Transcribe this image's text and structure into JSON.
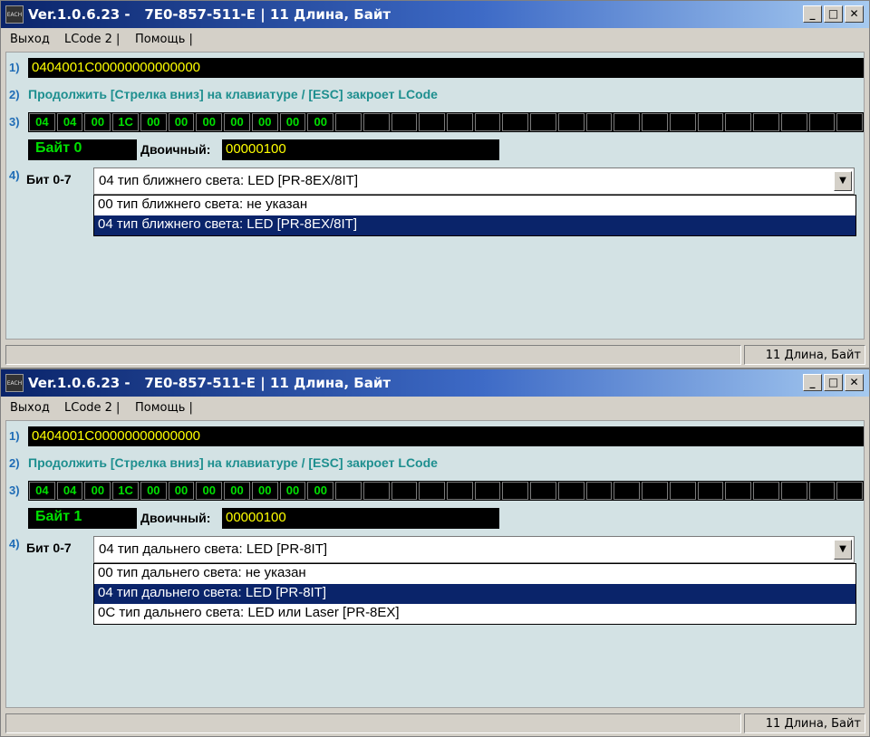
{
  "windows": [
    {
      "title": "Ver.1.0.6.23 -   7E0-857-511-E | 11 Длина, Байт",
      "app_icon_text": "EACH",
      "window_buttons": {
        "minimize": "_",
        "maximize": "□",
        "close": "✕"
      },
      "menu": [
        "Выход",
        "LCode 2 |",
        "Помощь |"
      ],
      "step_labels": [
        "1)",
        "2)",
        "3)",
        "4)"
      ],
      "lcode": "0404001C00000000000000",
      "hint": "Продолжить [Стрелка вниз] на клавиатуре / [ESC] закроет LCode",
      "bytes": [
        "04",
        "04",
        "00",
        "1C",
        "00",
        "00",
        "00",
        "00",
        "00",
        "00",
        "00",
        "",
        "",
        "",
        "",
        "",
        "",
        "",
        "",
        "",
        "",
        "",
        "",
        "",
        "",
        "",
        "",
        "",
        "",
        ""
      ],
      "byte_label": "Байт 0",
      "binary_label": "Двоичный:",
      "binary_value": "00000100",
      "bit_label": "Бит 0-7",
      "combo_value": "04 тип ближнего света: LED [PR-8EX/8IT]",
      "combo_arrow": "▼",
      "options": [
        {
          "label": "00 тип ближнего света: не указан",
          "selected": false
        },
        {
          "label": "04 тип ближнего света: LED [PR-8EX/8IT]",
          "selected": true
        }
      ],
      "status_right": "11 Длина, Байт"
    },
    {
      "title": "Ver.1.0.6.23 -   7E0-857-511-E | 11 Длина, Байт",
      "app_icon_text": "EACH",
      "window_buttons": {
        "minimize": "_",
        "maximize": "□",
        "close": "✕"
      },
      "menu": [
        "Выход",
        "LCode 2 |",
        "Помощь |"
      ],
      "step_labels": [
        "1)",
        "2)",
        "3)",
        "4)"
      ],
      "lcode": "0404001C00000000000000",
      "hint": "Продолжить [Стрелка вниз] на клавиатуре / [ESC] закроет LCode",
      "bytes": [
        "04",
        "04",
        "00",
        "1C",
        "00",
        "00",
        "00",
        "00",
        "00",
        "00",
        "00",
        "",
        "",
        "",
        "",
        "",
        "",
        "",
        "",
        "",
        "",
        "",
        "",
        "",
        "",
        "",
        "",
        "",
        "",
        ""
      ],
      "byte_label": "Байт 1",
      "binary_label": "Двоичный:",
      "binary_value": "00000100",
      "bit_label": "Бит 0-7",
      "combo_value": "04 тип дальнего света: LED [PR-8IT]",
      "combo_arrow": "▼",
      "options": [
        {
          "label": "00 тип дальнего света: не указан",
          "selected": false
        },
        {
          "label": "04 тип дальнего света: LED [PR-8IT]",
          "selected": true
        },
        {
          "label": "0C тип дальнего света: LED или Laser [PR-8EX]",
          "selected": false
        }
      ],
      "status_right": "11 Длина, Байт"
    }
  ]
}
